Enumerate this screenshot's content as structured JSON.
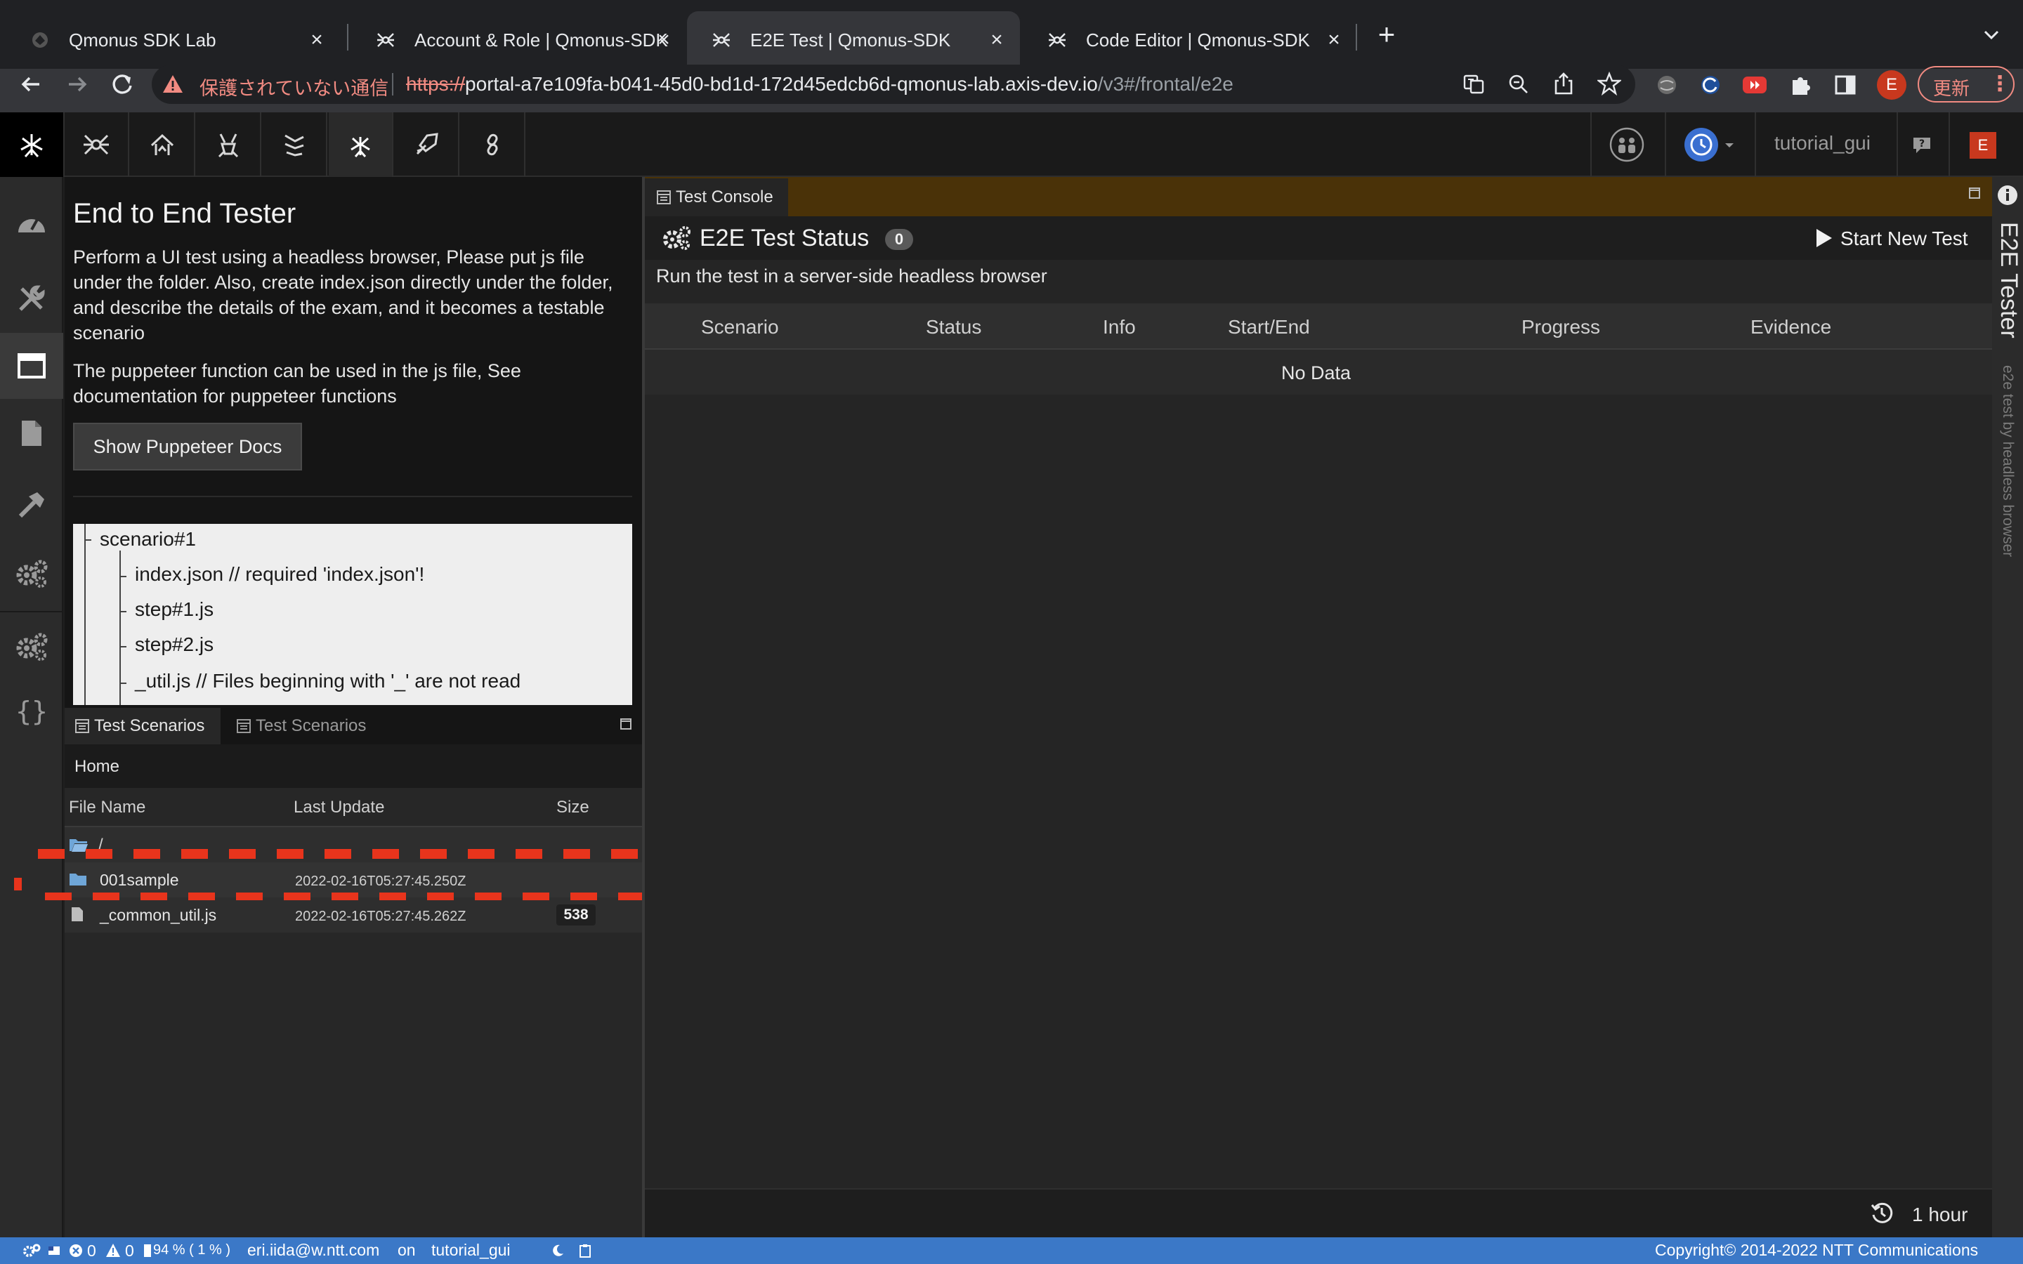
{
  "browser": {
    "tabs": [
      {
        "title": "Qmonus SDK Lab"
      },
      {
        "title": "Account & Role | Qmonus-SDK"
      },
      {
        "title": "E2E Test | Qmonus-SDK"
      },
      {
        "title": "Code Editor | Qmonus-SDK"
      }
    ],
    "security_text": "保護されていない通信",
    "url_scheme": "https://",
    "url_host": "portal-a7e109fa-b041-45d0-bd1d-172d45edcb6d-qmonus-lab.axis-dev.io",
    "url_path": "/v3#/frontal/e2e",
    "profile_initial": "E",
    "update_label": "更新"
  },
  "header": {
    "project": "tutorial_gui",
    "user_initial": "E"
  },
  "left_panel": {
    "title": "End to End Tester",
    "description": "Perform a UI test using a headless browser, Please put js file under the folder. Also, create index.json directly under the folder, and describe the details of the exam, and it becomes a testable scenario",
    "puppeteer_note": "The puppeteer function can be used in the js file, See documentation for puppeteer functions",
    "docs_button": "Show Puppeteer Docs",
    "tree": {
      "root": "scenario#1",
      "children": [
        "index.json // required 'index.json'!",
        "step#1.js",
        "step#2.js",
        "_util.js // Files beginning with '_' are not read"
      ]
    }
  },
  "scenarios_panel": {
    "tabs": [
      "Test Scenarios",
      "Test Scenarios"
    ],
    "breadcrumb": "Home",
    "columns": [
      "File Name",
      "Last Update",
      "Size"
    ],
    "root_label": "/",
    "rows": [
      {
        "name": "001sample",
        "updated": "2022-02-16T05:27:45.250Z",
        "size": "",
        "type": "folder"
      },
      {
        "name": "_common_util.js",
        "updated": "2022-02-16T05:27:45.262Z",
        "size": "538",
        "type": "file"
      }
    ]
  },
  "console_panel": {
    "tab": "Test Console",
    "title": "E2E Test Status",
    "count": "0",
    "start_button": "Start New Test",
    "subtitle": "Run the test in a server-side headless browser",
    "columns": [
      "Scenario",
      "Status",
      "Info",
      "Start/End",
      "Progress",
      "Evidence"
    ],
    "empty_text": "No Data",
    "refresh_label": "1 hour"
  },
  "right_rail": {
    "title": "E2E Tester",
    "subtitle": "e2e test by headless browser"
  },
  "status_bar": {
    "errors": "0",
    "warnings": "0",
    "memory": "94 % ( 1 % )",
    "user": "eri.iida@w.ntt.com",
    "on": "on",
    "project": "tutorial_gui",
    "copyright": "Copyright© 2014-2022 NTT Communications"
  },
  "colors": {
    "accent_orange": "#4a3208",
    "highlight_dash": "#e8341c",
    "status_blue": "#3b78c7",
    "avatar_red": "#c8381e"
  }
}
